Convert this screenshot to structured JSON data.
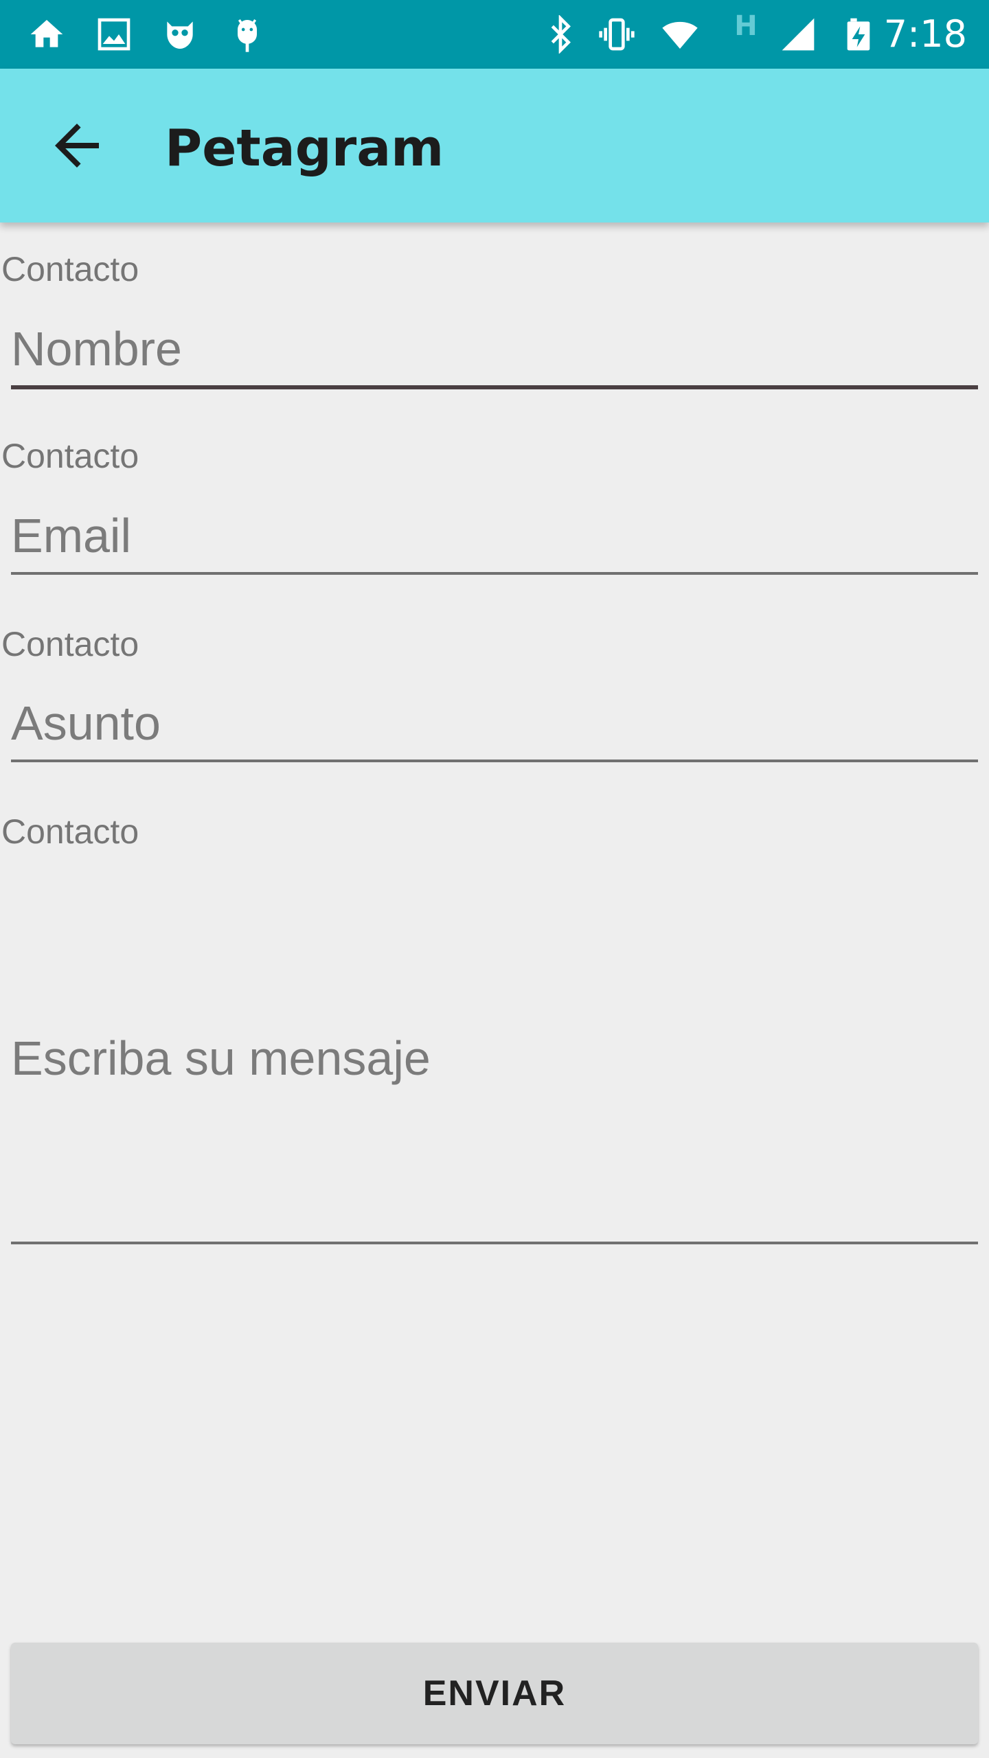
{
  "status_bar": {
    "time": "7:18",
    "network_type": "H",
    "left_icons": [
      "home-icon",
      "gallery-icon",
      "owl-icon",
      "android-icon"
    ],
    "right_icons": [
      "bluetooth-icon",
      "vibrate-icon",
      "wifi-icon",
      "signal-icon",
      "battery-charging-icon"
    ],
    "background_color": "#0097a7"
  },
  "app_bar": {
    "title": "Petagram",
    "back_icon": "arrow-left-icon",
    "background_color": "#74e1ea"
  },
  "form": {
    "fields": [
      {
        "label": "Contacto",
        "placeholder": "Nombre",
        "value": ""
      },
      {
        "label": "Contacto",
        "placeholder": "Email",
        "value": ""
      },
      {
        "label": "Contacto",
        "placeholder": "Asunto",
        "value": ""
      },
      {
        "label": "Contacto",
        "placeholder": "Escriba su mensaje",
        "value": ""
      }
    ],
    "submit_label": "ENVIAR"
  }
}
